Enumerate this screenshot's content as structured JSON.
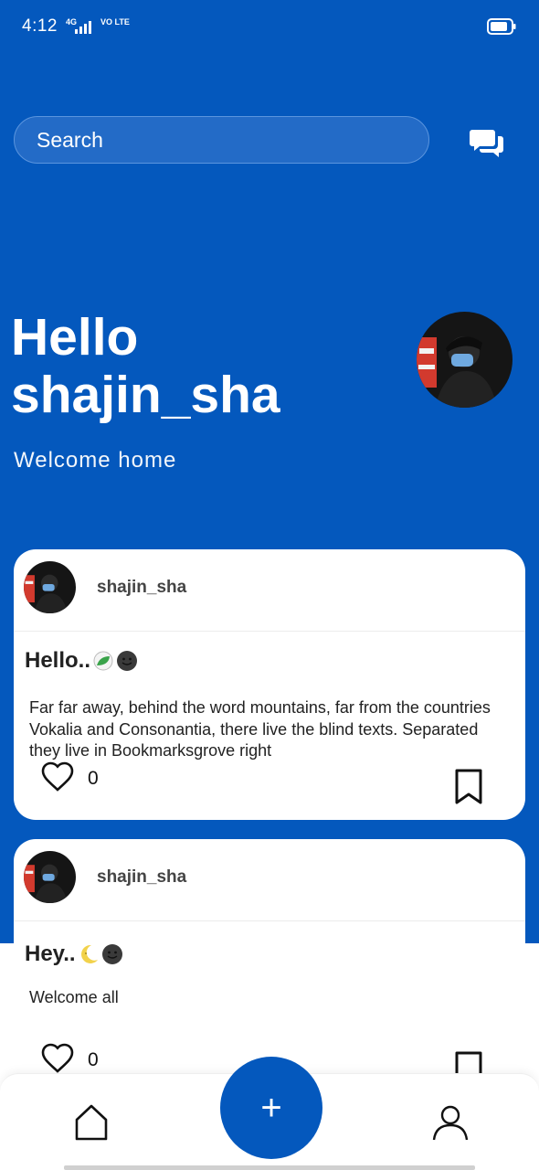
{
  "status_bar": {
    "time": "4:12",
    "network": "4G",
    "volte": "VO LTE",
    "icons": [
      "signal-icon",
      "battery-icon"
    ]
  },
  "search": {
    "placeholder": "Search"
  },
  "header": {
    "greeting_line1": "Hello",
    "greeting_line2": "shajin_sha",
    "welcome": "Welcome home"
  },
  "posts": [
    {
      "username": "shajin_sha",
      "title": "Hello..",
      "title_emojis": [
        "leaf-icon",
        "smiley-icon"
      ],
      "body": "Far far away, behind the word mountains, far from the countries Vokalia and Consonantia, there live the blind texts. Separated they live in Bookmarksgrove right",
      "likes": "0"
    },
    {
      "username": "shajin_sha",
      "title": "Hey..",
      "title_emojis": [
        "moon-icon",
        "smiley-icon"
      ],
      "body": "Welcome all",
      "likes": "0"
    }
  ],
  "fab": {
    "label": "+"
  },
  "nav": {
    "items": [
      "home-icon",
      "profile-icon"
    ]
  },
  "colors": {
    "primary": "#0458bd",
    "search_bg": "#236bc7",
    "card_bg": "#ffffff",
    "text_dark": "#222222"
  }
}
